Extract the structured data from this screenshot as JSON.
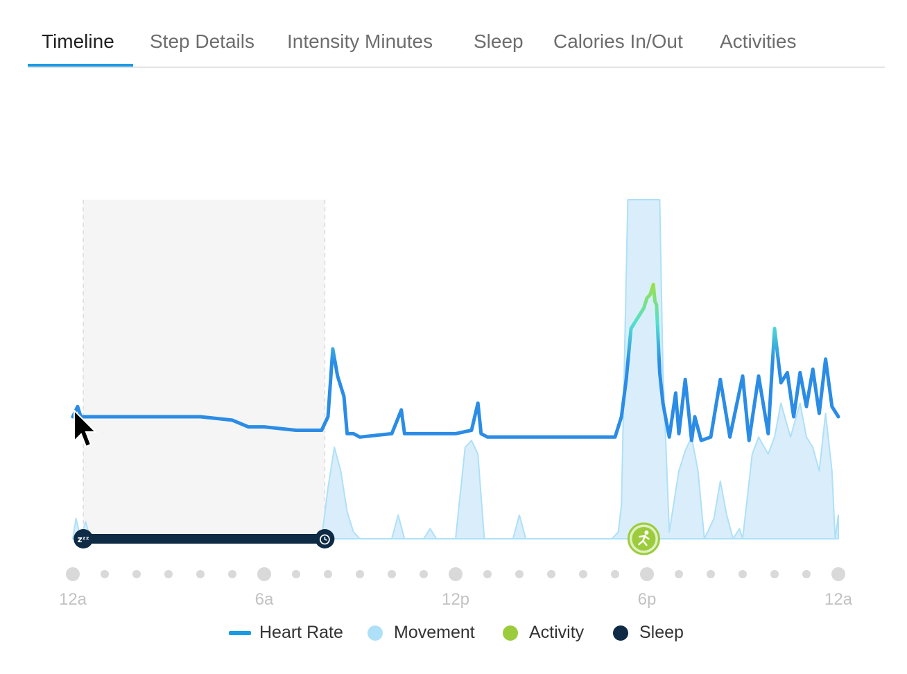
{
  "tabs": [
    {
      "label": "Timeline",
      "active": true
    },
    {
      "label": "Step Details",
      "active": false
    },
    {
      "label": "Intensity Minutes",
      "active": false
    },
    {
      "label": "Sleep",
      "active": false
    },
    {
      "label": "Calories In/Out",
      "active": false
    },
    {
      "label": "Activities",
      "active": false
    }
  ],
  "colors": {
    "heart_rate": "#2b8ce6",
    "heart_rate_high": "#52e0d0",
    "movement": "#aee0f8",
    "activity": "#9ccc3c",
    "sleep": "#0f2a45",
    "tab_active": "#1a9be6",
    "sleep_shade": "#f5f5f5",
    "tick_dot": "#d9d9d9"
  },
  "chart_data": {
    "type": "line",
    "x_unit": "hours",
    "xlim": [
      0,
      24
    ],
    "ylim": [
      0,
      1
    ],
    "x_ticks": [
      {
        "x": 0,
        "label": "12a"
      },
      {
        "x": 6,
        "label": "6a"
      },
      {
        "x": 12,
        "label": "12p"
      },
      {
        "x": 18,
        "label": "6p"
      },
      {
        "x": 24,
        "label": "12a"
      }
    ],
    "minor_tick_step": 1,
    "legend": [
      {
        "name": "Heart Rate",
        "type": "line",
        "color": "#2b8ce6"
      },
      {
        "name": "Movement",
        "type": "dot",
        "color": "#aee0f8"
      },
      {
        "name": "Activity",
        "type": "dot",
        "color": "#9ccc3c"
      },
      {
        "name": "Sleep",
        "type": "dot",
        "color": "#0f2a45"
      }
    ],
    "sleep_interval": {
      "start": 0.33,
      "end": 7.9
    },
    "activity_markers": [
      {
        "x": 17.9,
        "icon": "running-icon"
      }
    ],
    "series": [
      {
        "name": "Heart Rate",
        "x": [
          0,
          0.15,
          0.25,
          0.35,
          1,
          2,
          3,
          4,
          5,
          5.5,
          6,
          7,
          7.8,
          8.0,
          8.15,
          8.3,
          8.5,
          8.6,
          8.8,
          9,
          10,
          10.3,
          10.4,
          10.6,
          11,
          12,
          12.5,
          12.7,
          12.8,
          13,
          14,
          15,
          16,
          17,
          17.2,
          17.35,
          17.5,
          17.7,
          17.9,
          18.0,
          18.1,
          18.2,
          18.25,
          18.3,
          18.4,
          18.5,
          18.7,
          18.9,
          19.0,
          19.2,
          19.4,
          19.5,
          19.7,
          20,
          20.3,
          20.6,
          21,
          21.2,
          21.5,
          21.8,
          22.0,
          22.2,
          22.4,
          22.6,
          22.8,
          23.0,
          23.2,
          23.4,
          23.6,
          23.8,
          24
        ],
        "values": [
          0.36,
          0.39,
          0.36,
          0.36,
          0.36,
          0.36,
          0.36,
          0.36,
          0.35,
          0.33,
          0.33,
          0.32,
          0.32,
          0.36,
          0.56,
          0.48,
          0.42,
          0.31,
          0.31,
          0.3,
          0.31,
          0.38,
          0.31,
          0.31,
          0.31,
          0.31,
          0.32,
          0.4,
          0.31,
          0.3,
          0.3,
          0.3,
          0.3,
          0.3,
          0.36,
          0.47,
          0.62,
          0.65,
          0.68,
          0.71,
          0.72,
          0.75,
          0.7,
          0.69,
          0.49,
          0.4,
          0.3,
          0.43,
          0.31,
          0.47,
          0.29,
          0.36,
          0.29,
          0.3,
          0.47,
          0.3,
          0.48,
          0.29,
          0.48,
          0.31,
          0.62,
          0.46,
          0.49,
          0.36,
          0.49,
          0.39,
          0.5,
          0.37,
          0.53,
          0.39,
          0.36
        ]
      },
      {
        "name": "Movement",
        "x": [
          0,
          0.1,
          0.25,
          0.4,
          0.55,
          0.7,
          0.9,
          7.8,
          8.0,
          8.2,
          8.4,
          8.6,
          8.8,
          9.0,
          9.1,
          10.0,
          10.2,
          10.4,
          11,
          11.2,
          11.4,
          12.0,
          12.3,
          12.5,
          12.7,
          12.9,
          13.2,
          13.8,
          14.0,
          14.2,
          16.9,
          17.1,
          17.2,
          17.4,
          17.6,
          17.8,
          18.0,
          18.2,
          18.4,
          18.5,
          18.7,
          19.0,
          19.2,
          19.4,
          19.6,
          19.8,
          20.1,
          20.3,
          20.5,
          20.7,
          20.9,
          21.0,
          21.3,
          21.5,
          21.8,
          22.0,
          22.2,
          22.5,
          22.8,
          23.0,
          23.2,
          23.4,
          23.6,
          23.8,
          23.9,
          24
        ],
        "values": [
          0,
          0.06,
          0.0,
          0.05,
          0.0,
          0.0,
          0.0,
          0.0,
          0.15,
          0.27,
          0.2,
          0.08,
          0.02,
          0.0,
          0.0,
          0.0,
          0.07,
          0.0,
          0.0,
          0.03,
          0.0,
          0.0,
          0.27,
          0.29,
          0.25,
          0.0,
          0.0,
          0.0,
          0.07,
          0.0,
          0.0,
          0.02,
          0.1,
          1.0,
          1.0,
          1.0,
          1.0,
          1.0,
          1.0,
          0.5,
          0.02,
          0.2,
          0.26,
          0.3,
          0.2,
          0.0,
          0.06,
          0.17,
          0.07,
          0.0,
          0.03,
          0.0,
          0.25,
          0.3,
          0.25,
          0.3,
          0.4,
          0.3,
          0.4,
          0.3,
          0.27,
          0.2,
          0.37,
          0.2,
          0.0,
          0.07
        ]
      }
    ]
  }
}
